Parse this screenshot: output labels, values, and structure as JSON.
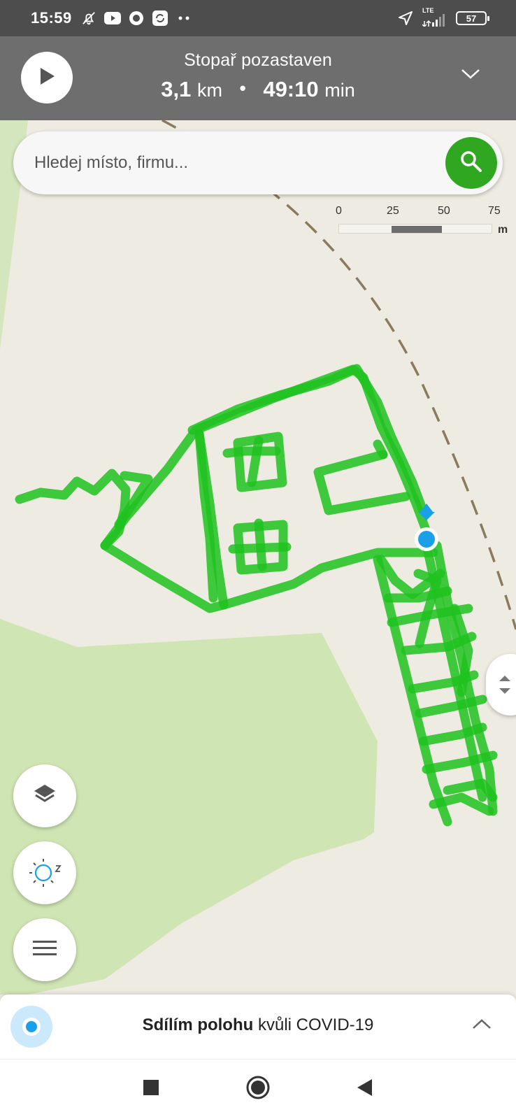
{
  "status_bar": {
    "time": "15:59",
    "left_icons": [
      "mute-bell-icon",
      "youtube-icon",
      "record-icon",
      "sync-app-icon",
      "more-dots-icon"
    ],
    "right_icons": [
      "location-arrow-icon",
      "lte-signal-icon"
    ],
    "network_label": "LTE",
    "battery": "57"
  },
  "tracker": {
    "title": "Stopař pozastaven",
    "distance_value": "3,1",
    "distance_unit": "km",
    "separator": "•",
    "duration_value": "49:10",
    "duration_unit": "min"
  },
  "search": {
    "placeholder": "Hledej místo, firmu..."
  },
  "scale": {
    "labels": [
      "0",
      "25",
      "50",
      "75"
    ],
    "unit": "m"
  },
  "map": {
    "track_color": "#1ec21e",
    "location_color": "#1aa0e8",
    "background_color": "#eeece2",
    "forest_color": "#cfe4b4"
  },
  "share_bar": {
    "bold_text": "Sdílím polohu",
    "normal_text": " kvůli COVID-19"
  },
  "nav": {
    "buttons": [
      "recent-apps-button",
      "home-button",
      "back-button"
    ]
  }
}
